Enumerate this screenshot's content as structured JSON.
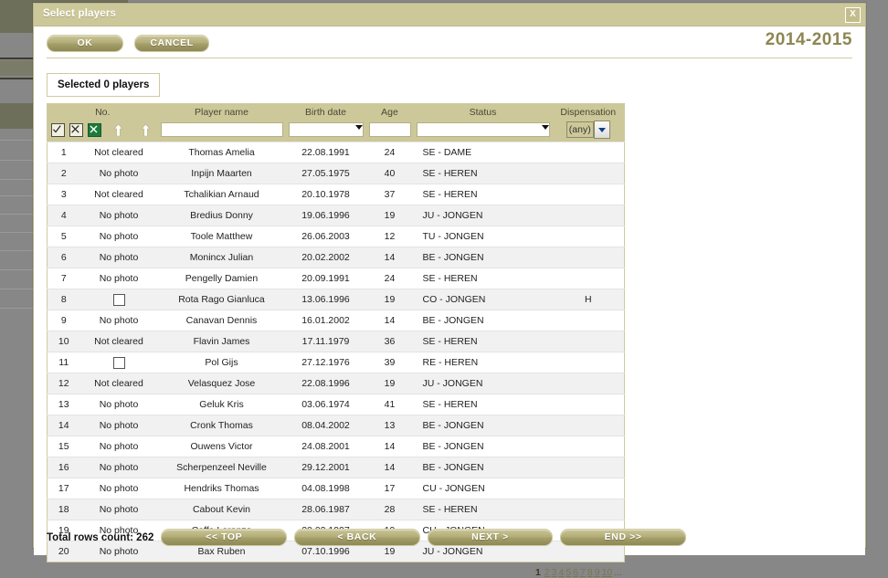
{
  "background": {
    "cancel_label": "CANCEL"
  },
  "dialog": {
    "title": "Select players",
    "close_label": "X",
    "ok_label": "OK",
    "cancel_label": "CANCEL",
    "season": "2014-2015",
    "selected_label": "Selected 0 players"
  },
  "icons": {
    "select_all": "check-all-icon",
    "deselect_all": "uncheck-all-icon",
    "export_excel": "excel-export-icon",
    "sort_asc_name": "sort-ascending-arrow-icon",
    "sort_asc_status": "sort-ascending-arrow-icon"
  },
  "table": {
    "columns": [
      {
        "key": "no",
        "label": "No."
      },
      {
        "key": "clearance",
        "label": ""
      },
      {
        "key": "player_name",
        "label": "Player name"
      },
      {
        "key": "birth_date",
        "label": "Birth date"
      },
      {
        "key": "age",
        "label": "Age"
      },
      {
        "key": "status",
        "label": "Status"
      },
      {
        "key": "dispensation",
        "label": "Dispensation"
      }
    ],
    "filters": {
      "player_name": "",
      "player_name_placeholder": "",
      "birth_date": "",
      "age": "",
      "status": "",
      "dispensation": "(any)"
    },
    "rows": [
      {
        "no": "1",
        "clearance": "Not cleared",
        "checkbox": false,
        "player_name": "Thomas Amelia",
        "birth_date": "22.08.1991",
        "age": "24",
        "status": "SE - DAME",
        "dispensation": ""
      },
      {
        "no": "2",
        "clearance": "No photo",
        "checkbox": false,
        "player_name": "Inpijn Maarten",
        "birth_date": "27.05.1975",
        "age": "40",
        "status": "SE - HEREN",
        "dispensation": ""
      },
      {
        "no": "3",
        "clearance": "Not cleared",
        "checkbox": false,
        "player_name": "Tchalikian Arnaud",
        "birth_date": "20.10.1978",
        "age": "37",
        "status": "SE - HEREN",
        "dispensation": ""
      },
      {
        "no": "4",
        "clearance": "No photo",
        "checkbox": false,
        "player_name": "Bredius Donny",
        "birth_date": "19.06.1996",
        "age": "19",
        "status": "JU - JONGEN",
        "dispensation": ""
      },
      {
        "no": "5",
        "clearance": "No photo",
        "checkbox": false,
        "player_name": "Toole Matthew",
        "birth_date": "26.06.2003",
        "age": "12",
        "status": "TU - JONGEN",
        "dispensation": ""
      },
      {
        "no": "6",
        "clearance": "No photo",
        "checkbox": false,
        "player_name": "Monincx Julian",
        "birth_date": "20.02.2002",
        "age": "14",
        "status": "BE - JONGEN",
        "dispensation": ""
      },
      {
        "no": "7",
        "clearance": "No photo",
        "checkbox": false,
        "player_name": "Pengelly Damien",
        "birth_date": "20.09.1991",
        "age": "24",
        "status": "SE - HEREN",
        "dispensation": ""
      },
      {
        "no": "8",
        "clearance": "",
        "checkbox": true,
        "player_name": "Rota Rago Gianluca",
        "birth_date": "13.06.1996",
        "age": "19",
        "status": "CO - JONGEN",
        "dispensation": "H"
      },
      {
        "no": "9",
        "clearance": "No photo",
        "checkbox": false,
        "player_name": "Canavan Dennis",
        "birth_date": "16.01.2002",
        "age": "14",
        "status": "BE - JONGEN",
        "dispensation": ""
      },
      {
        "no": "10",
        "clearance": "Not cleared",
        "checkbox": false,
        "player_name": "Flavin James",
        "birth_date": "17.11.1979",
        "age": "36",
        "status": "SE - HEREN",
        "dispensation": ""
      },
      {
        "no": "11",
        "clearance": "",
        "checkbox": true,
        "player_name": "Pol Gijs",
        "birth_date": "27.12.1976",
        "age": "39",
        "status": "RE - HEREN",
        "dispensation": ""
      },
      {
        "no": "12",
        "clearance": "Not cleared",
        "checkbox": false,
        "player_name": "Velasquez Jose",
        "birth_date": "22.08.1996",
        "age": "19",
        "status": "JU - JONGEN",
        "dispensation": ""
      },
      {
        "no": "13",
        "clearance": "No photo",
        "checkbox": false,
        "player_name": "Geluk Kris",
        "birth_date": "03.06.1974",
        "age": "41",
        "status": "SE - HEREN",
        "dispensation": ""
      },
      {
        "no": "14",
        "clearance": "No photo",
        "checkbox": false,
        "player_name": "Cronk Thomas",
        "birth_date": "08.04.2002",
        "age": "13",
        "status": "BE - JONGEN",
        "dispensation": ""
      },
      {
        "no": "15",
        "clearance": "No photo",
        "checkbox": false,
        "player_name": "Ouwens Victor",
        "birth_date": "24.08.2001",
        "age": "14",
        "status": "BE - JONGEN",
        "dispensation": ""
      },
      {
        "no": "16",
        "clearance": "No photo",
        "checkbox": false,
        "player_name": "Scherpenzeel Neville",
        "birth_date": "29.12.2001",
        "age": "14",
        "status": "BE - JONGEN",
        "dispensation": ""
      },
      {
        "no": "17",
        "clearance": "No photo",
        "checkbox": false,
        "player_name": "Hendriks Thomas",
        "birth_date": "04.08.1998",
        "age": "17",
        "status": "CU - JONGEN",
        "dispensation": ""
      },
      {
        "no": "18",
        "clearance": "No photo",
        "checkbox": false,
        "player_name": "Cabout Kevin",
        "birth_date": "28.06.1987",
        "age": "28",
        "status": "SE - HEREN",
        "dispensation": ""
      },
      {
        "no": "19",
        "clearance": "No photo",
        "checkbox": false,
        "player_name": "Caffa Lorenzo",
        "birth_date": "20.02.1997",
        "age": "19",
        "status": "CU - JONGEN",
        "dispensation": ""
      },
      {
        "no": "20",
        "clearance": "No photo",
        "checkbox": false,
        "player_name": "Bax Ruben",
        "birth_date": "07.10.1996",
        "age": "19",
        "status": "JU - JONGEN",
        "dispensation": ""
      }
    ]
  },
  "pagination": {
    "current": "1",
    "pages": [
      "2",
      "3",
      "4",
      "5",
      "6",
      "7",
      "8",
      "9",
      "10"
    ],
    "more": "..."
  },
  "footer": {
    "rowcount_label": "Total rows count: 262",
    "top_label": "<< TOP",
    "back_label": "< BACK",
    "next_label": "NEXT >",
    "end_label": "END >>"
  },
  "colors": {
    "accent": "#cdc89a",
    "button": "#a49e68",
    "warning": "#e8403a",
    "season": "#8d8652"
  }
}
